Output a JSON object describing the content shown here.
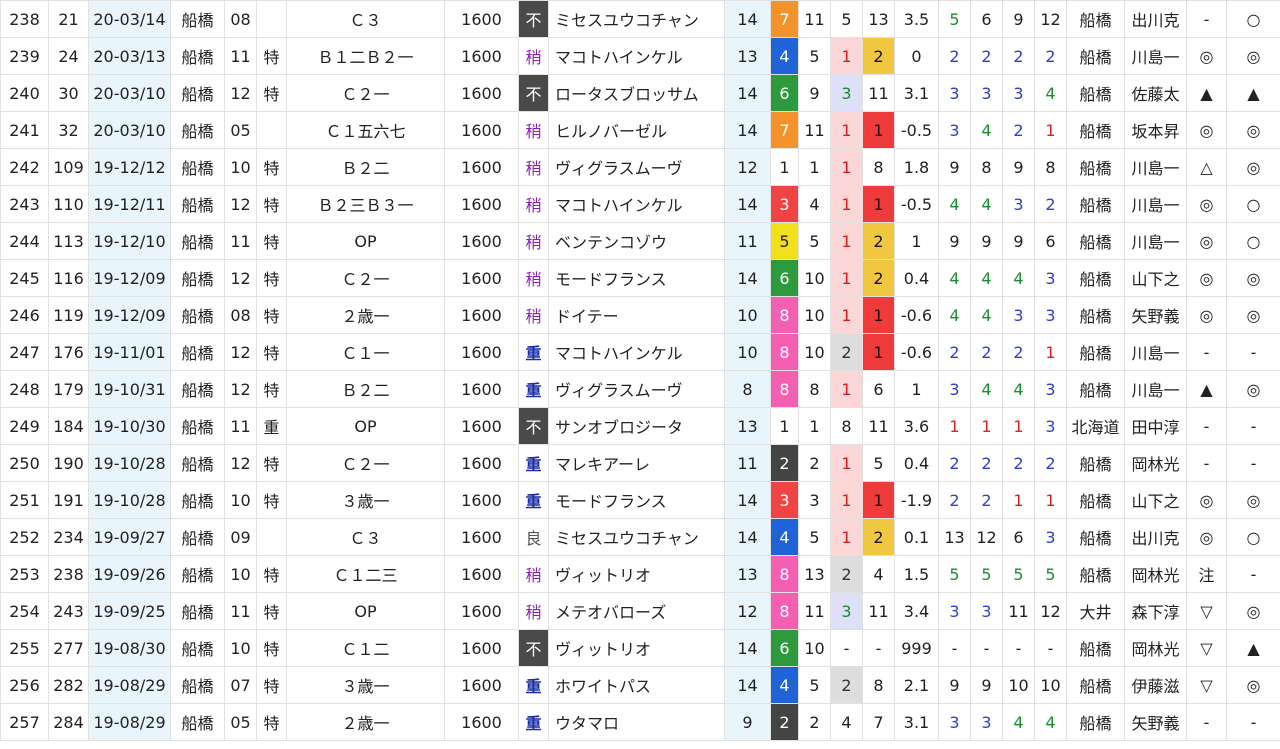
{
  "rows": [
    {
      "no": "238",
      "num": "21",
      "date": "20-03/14",
      "track": "船橋",
      "race": "08",
      "grade": "",
      "cls": "Ｃ３",
      "dist": "1600",
      "cond": "不",
      "horse": "ミセスユウコチャン",
      "heads": "14",
      "waku": "7",
      "uma": "11",
      "pop": "5",
      "rank": "13",
      "diff": "3.5",
      "c1": "5",
      "c2": "6",
      "c3": "9",
      "c4": "12",
      "venue": "船橋",
      "jockey": "出川克",
      "m1": "-",
      "m2": "○"
    },
    {
      "no": "239",
      "num": "24",
      "date": "20-03/13",
      "track": "船橋",
      "race": "11",
      "grade": "特",
      "cls": "Ｂ１二Ｂ２一",
      "dist": "1600",
      "cond": "稍",
      "horse": "マコトハインケル",
      "heads": "13",
      "waku": "4",
      "uma": "5",
      "pop": "1",
      "rank": "2",
      "diff": "0",
      "c1": "2",
      "c2": "2",
      "c3": "2",
      "c4": "2",
      "venue": "船橋",
      "jockey": "川島一",
      "m1": "◎",
      "m2": "◎"
    },
    {
      "no": "240",
      "num": "30",
      "date": "20-03/10",
      "track": "船橋",
      "race": "12",
      "grade": "特",
      "cls": "Ｃ２一",
      "dist": "1600",
      "cond": "不",
      "horse": "ロータスブロッサム",
      "heads": "14",
      "waku": "6",
      "uma": "9",
      "pop": "3",
      "rank": "11",
      "diff": "3.1",
      "c1": "3",
      "c2": "3",
      "c3": "3",
      "c4": "4",
      "venue": "船橋",
      "jockey": "佐藤太",
      "m1": "▲",
      "m2": "▲"
    },
    {
      "no": "241",
      "num": "32",
      "date": "20-03/10",
      "track": "船橋",
      "race": "05",
      "grade": "",
      "cls": "Ｃ１五六七",
      "dist": "1600",
      "cond": "稍",
      "horse": "ヒルノバーゼル",
      "heads": "14",
      "waku": "7",
      "uma": "11",
      "pop": "1",
      "rank": "1",
      "diff": "-0.5",
      "c1": "3",
      "c2": "4",
      "c3": "2",
      "c4": "1",
      "venue": "船橋",
      "jockey": "坂本昇",
      "m1": "◎",
      "m2": "◎"
    },
    {
      "no": "242",
      "num": "109",
      "date": "19-12/12",
      "track": "船橋",
      "race": "10",
      "grade": "特",
      "cls": "Ｂ２二",
      "dist": "1600",
      "cond": "稍",
      "horse": "ヴィグラスムーヴ",
      "heads": "12",
      "waku": "1",
      "uma": "1",
      "pop": "1",
      "rank": "8",
      "diff": "1.8",
      "c1": "9",
      "c2": "8",
      "c3": "9",
      "c4": "8",
      "venue": "船橋",
      "jockey": "川島一",
      "m1": "△",
      "m2": "◎"
    },
    {
      "no": "243",
      "num": "110",
      "date": "19-12/11",
      "track": "船橋",
      "race": "12",
      "grade": "特",
      "cls": "Ｂ２三Ｂ３一",
      "dist": "1600",
      "cond": "稍",
      "horse": "マコトハインケル",
      "heads": "14",
      "waku": "3",
      "uma": "4",
      "pop": "1",
      "rank": "1",
      "diff": "-0.5",
      "c1": "4",
      "c2": "4",
      "c3": "3",
      "c4": "2",
      "venue": "船橋",
      "jockey": "川島一",
      "m1": "◎",
      "m2": "○"
    },
    {
      "no": "244",
      "num": "113",
      "date": "19-12/10",
      "track": "船橋",
      "race": "11",
      "grade": "特",
      "cls": "OP",
      "dist": "1600",
      "cond": "稍",
      "horse": "ベンテンコゾウ",
      "heads": "11",
      "waku": "5",
      "uma": "5",
      "pop": "1",
      "rank": "2",
      "diff": "1",
      "c1": "9",
      "c2": "9",
      "c3": "9",
      "c4": "6",
      "venue": "船橋",
      "jockey": "川島一",
      "m1": "◎",
      "m2": "○"
    },
    {
      "no": "245",
      "num": "116",
      "date": "19-12/09",
      "track": "船橋",
      "race": "12",
      "grade": "特",
      "cls": "Ｃ２一",
      "dist": "1600",
      "cond": "稍",
      "horse": "モードフランス",
      "heads": "14",
      "waku": "6",
      "uma": "10",
      "pop": "1",
      "rank": "2",
      "diff": "0.4",
      "c1": "4",
      "c2": "4",
      "c3": "4",
      "c4": "3",
      "venue": "船橋",
      "jockey": "山下之",
      "m1": "◎",
      "m2": "◎"
    },
    {
      "no": "246",
      "num": "119",
      "date": "19-12/09",
      "track": "船橋",
      "race": "08",
      "grade": "特",
      "cls": "２歳一",
      "dist": "1600",
      "cond": "稍",
      "horse": "ドイテー",
      "heads": "10",
      "waku": "8",
      "uma": "10",
      "pop": "1",
      "rank": "1",
      "diff": "-0.6",
      "c1": "4",
      "c2": "4",
      "c3": "3",
      "c4": "3",
      "venue": "船橋",
      "jockey": "矢野義",
      "m1": "◎",
      "m2": "◎"
    },
    {
      "no": "247",
      "num": "176",
      "date": "19-11/01",
      "track": "船橋",
      "race": "12",
      "grade": "特",
      "cls": "Ｃ１一",
      "dist": "1600",
      "cond": "重",
      "horse": "マコトハインケル",
      "heads": "10",
      "waku": "8",
      "uma": "10",
      "pop": "2",
      "rank": "1",
      "diff": "-0.6",
      "c1": "2",
      "c2": "2",
      "c3": "2",
      "c4": "1",
      "venue": "船橋",
      "jockey": "川島一",
      "m1": "-",
      "m2": "-"
    },
    {
      "no": "248",
      "num": "179",
      "date": "19-10/31",
      "track": "船橋",
      "race": "12",
      "grade": "特",
      "cls": "Ｂ２二",
      "dist": "1600",
      "cond": "重",
      "horse": "ヴィグラスムーヴ",
      "heads": "8",
      "waku": "8",
      "uma": "8",
      "pop": "1",
      "rank": "6",
      "diff": "1",
      "c1": "3",
      "c2": "4",
      "c3": "4",
      "c4": "3",
      "venue": "船橋",
      "jockey": "川島一",
      "m1": "▲",
      "m2": "◎"
    },
    {
      "no": "249",
      "num": "184",
      "date": "19-10/30",
      "track": "船橋",
      "race": "11",
      "grade": "重",
      "cls": "OP",
      "dist": "1600",
      "cond": "不",
      "horse": "サンオブロジータ",
      "heads": "13",
      "waku": "1",
      "uma": "1",
      "pop": "8",
      "rank": "11",
      "diff": "3.6",
      "c1": "1",
      "c2": "1",
      "c3": "1",
      "c4": "3",
      "venue": "北海道",
      "jockey": "田中淳",
      "m1": "-",
      "m2": "-"
    },
    {
      "no": "250",
      "num": "190",
      "date": "19-10/28",
      "track": "船橋",
      "race": "12",
      "grade": "特",
      "cls": "Ｃ２一",
      "dist": "1600",
      "cond": "重",
      "horse": "マレキアーレ",
      "heads": "11",
      "waku": "2",
      "uma": "2",
      "pop": "1",
      "rank": "5",
      "diff": "0.4",
      "c1": "2",
      "c2": "2",
      "c3": "2",
      "c4": "2",
      "venue": "船橋",
      "jockey": "岡林光",
      "m1": "-",
      "m2": "-"
    },
    {
      "no": "251",
      "num": "191",
      "date": "19-10/28",
      "track": "船橋",
      "race": "10",
      "grade": "特",
      "cls": "３歳一",
      "dist": "1600",
      "cond": "重",
      "horse": "モードフランス",
      "heads": "14",
      "waku": "3",
      "uma": "3",
      "pop": "1",
      "rank": "1",
      "diff": "-1.9",
      "c1": "2",
      "c2": "2",
      "c3": "1",
      "c4": "1",
      "venue": "船橋",
      "jockey": "山下之",
      "m1": "◎",
      "m2": "◎"
    },
    {
      "no": "252",
      "num": "234",
      "date": "19-09/27",
      "track": "船橋",
      "race": "09",
      "grade": "",
      "cls": "Ｃ３",
      "dist": "1600",
      "cond": "良",
      "horse": "ミセスユウコチャン",
      "heads": "14",
      "waku": "4",
      "uma": "5",
      "pop": "1",
      "rank": "2",
      "diff": "0.1",
      "c1": "13",
      "c2": "12",
      "c3": "6",
      "c4": "3",
      "venue": "船橋",
      "jockey": "出川克",
      "m1": "◎",
      "m2": "○"
    },
    {
      "no": "253",
      "num": "238",
      "date": "19-09/26",
      "track": "船橋",
      "race": "10",
      "grade": "特",
      "cls": "Ｃ１二三",
      "dist": "1600",
      "cond": "稍",
      "horse": "ヴィットリオ",
      "heads": "13",
      "waku": "8",
      "uma": "13",
      "pop": "2",
      "rank": "4",
      "diff": "1.5",
      "c1": "5",
      "c2": "5",
      "c3": "5",
      "c4": "5",
      "venue": "船橋",
      "jockey": "岡林光",
      "m1": "注",
      "m2": "-"
    },
    {
      "no": "254",
      "num": "243",
      "date": "19-09/25",
      "track": "船橋",
      "race": "11",
      "grade": "特",
      "cls": "OP",
      "dist": "1600",
      "cond": "稍",
      "horse": "メテオバローズ",
      "heads": "12",
      "waku": "8",
      "uma": "11",
      "pop": "3",
      "rank": "11",
      "diff": "3.4",
      "c1": "3",
      "c2": "3",
      "c3": "11",
      "c4": "12",
      "venue": "大井",
      "jockey": "森下淳",
      "m1": "▽",
      "m2": "◎"
    },
    {
      "no": "255",
      "num": "277",
      "date": "19-08/30",
      "track": "船橋",
      "race": "10",
      "grade": "特",
      "cls": "Ｃ１二",
      "dist": "1600",
      "cond": "不",
      "horse": "ヴィットリオ",
      "heads": "14",
      "waku": "6",
      "uma": "10",
      "pop": "-",
      "rank": "-",
      "diff": "999",
      "c1": "-",
      "c2": "-",
      "c3": "-",
      "c4": "-",
      "venue": "船橋",
      "jockey": "岡林光",
      "m1": "▽",
      "m2": "▲"
    },
    {
      "no": "256",
      "num": "282",
      "date": "19-08/29",
      "track": "船橋",
      "race": "07",
      "grade": "特",
      "cls": "３歳一",
      "dist": "1600",
      "cond": "重",
      "horse": "ホワイトパス",
      "heads": "14",
      "waku": "4",
      "uma": "5",
      "pop": "2",
      "rank": "8",
      "diff": "2.1",
      "c1": "9",
      "c2": "9",
      "c3": "10",
      "c4": "10",
      "venue": "船橋",
      "jockey": "伊藤滋",
      "m1": "▽",
      "m2": "◎"
    },
    {
      "no": "257",
      "num": "284",
      "date": "19-08/29",
      "track": "船橋",
      "race": "05",
      "grade": "特",
      "cls": "２歳一",
      "dist": "1600",
      "cond": "重",
      "horse": "ウタマロ",
      "heads": "9",
      "waku": "2",
      "uma": "2",
      "pop": "4",
      "rank": "7",
      "diff": "3.1",
      "c1": "3",
      "c2": "3",
      "c3": "4",
      "c4": "4",
      "venue": "船橋",
      "jockey": "矢野義",
      "m1": "-",
      "m2": "-"
    }
  ]
}
